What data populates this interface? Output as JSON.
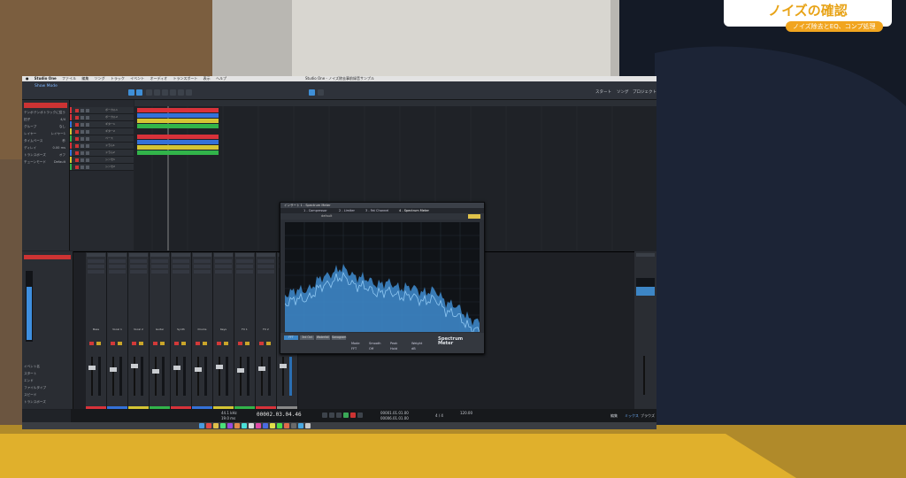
{
  "caption": {
    "title": "ノイズの確認",
    "subtitle": "ノイズ除去とEQ、コンプ処理"
  },
  "colors": {
    "caption_accent": "#f1a51f",
    "spectrum_fill": "#3d86c6",
    "clip_red": "#d8323a",
    "clip_blue": "#3471d8",
    "clip_yellow": "#d4c534",
    "clip_green": "#32b44a"
  },
  "daw": {
    "mac_menu": [
      "Studio One",
      "ファイル",
      "編集",
      "ソング",
      "トラック",
      "イベント",
      "オーディオ",
      "トランスポート",
      "表示",
      "ヘルプ"
    ],
    "window_title": "Studio One - ノイズ除去事前録音サンプル",
    "toolbar": {
      "left_label": "Show Mode",
      "right_items": [
        "スタート",
        "ソング",
        "プロジェクト"
      ]
    },
    "inspector_rows": [
      {
        "k": "テンポ",
        "v": "テンポトラックに従う"
      },
      {
        "k": "拍子",
        "v": "4/4"
      },
      {
        "k": "グループ",
        "v": "なし"
      },
      {
        "k": "レイヤー",
        "v": "レイヤー1"
      },
      {
        "k": "タイムベース",
        "v": "秒"
      },
      {
        "k": "ディレイ",
        "v": "0.00 ms"
      },
      {
        "k": "トランスポーズ",
        "v": "オフ"
      },
      {
        "k": "チューンモード",
        "v": "Default"
      }
    ],
    "tracks": [
      "ボーカル1",
      "ボーカル2",
      "ギター1",
      "ギター2",
      "ベース",
      "ドラム1",
      "ドラム2",
      "シンセ1",
      "シンセ2"
    ],
    "mixer_channels": [
      "Bass",
      "Vocal 1",
      "Vocal 2",
      "Guitar",
      "Synth",
      "Drums",
      "Keys",
      "FX 1",
      "FX 2",
      "Main"
    ],
    "left_panel_rows": [
      "イベント名",
      "スタート",
      "エンド",
      "ファイルタイプ",
      "スピード",
      "トランスポーズ",
      "チューン"
    ],
    "transport": {
      "position": "00002.03.04.46",
      "sample_rate": "44.1 kHz",
      "latency": "19.0 ms",
      "tempo": "120.00",
      "signature": "4 / 4",
      "left_locator": "00001.01.01.00",
      "right_locator": "00006.01.01.00"
    },
    "bottom_right_tabs": [
      "編集",
      "ミックス",
      "ブラウズ"
    ]
  },
  "plugin": {
    "window_title": "インサート 1 - Spectrum Meter",
    "tabs": [
      "1 - Compressor",
      "2 - Limiter",
      "3 - Fat Channel",
      "4 - Spectrum Meter"
    ],
    "preset": "default",
    "logo_line1": "Spectrum",
    "logo_line2": "Meter",
    "buttons": [
      "FFT",
      "3rd Oct",
      "Waterfall",
      "Sonogram"
    ],
    "controls": [
      {
        "label": "Mode",
        "value": "FFT"
      },
      {
        "label": "Smooth",
        "value": "Off"
      },
      {
        "label": "Peak",
        "value": "Hold"
      },
      {
        "label": "Weight",
        "value": "dB"
      }
    ]
  }
}
